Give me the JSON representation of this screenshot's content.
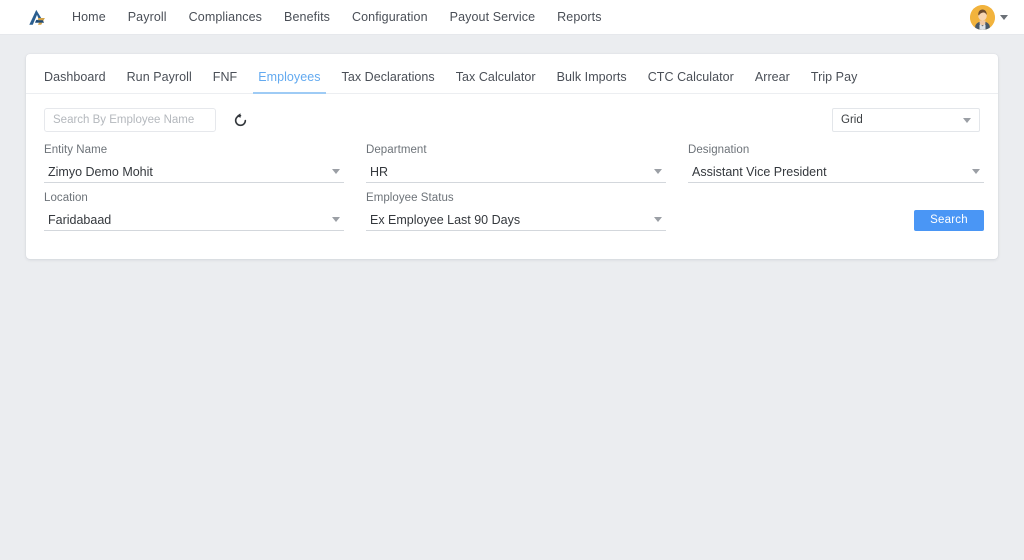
{
  "topbar": {
    "logo_icon": "arrow-a-logo-icon",
    "nav_items": [
      {
        "label": "Home"
      },
      {
        "label": "Payroll"
      },
      {
        "label": "Compliances"
      },
      {
        "label": "Benefits"
      },
      {
        "label": "Configuration"
      },
      {
        "label": "Payout Service"
      },
      {
        "label": "Reports"
      }
    ],
    "user": {
      "avatar_icon": "user-avatar",
      "caret_icon": "chevron-down-icon"
    }
  },
  "tabs": [
    {
      "label": "Dashboard",
      "active": false
    },
    {
      "label": "Run Payroll",
      "active": false
    },
    {
      "label": "FNF",
      "active": false
    },
    {
      "label": "Employees",
      "active": true
    },
    {
      "label": "Tax Declarations",
      "active": false
    },
    {
      "label": "Tax Calculator",
      "active": false
    },
    {
      "label": "Bulk Imports",
      "active": false
    },
    {
      "label": "CTC Calculator",
      "active": false
    },
    {
      "label": "Arrear",
      "active": false
    },
    {
      "label": "Trip Pay",
      "active": false
    }
  ],
  "toolbar": {
    "search": {
      "placeholder": "Search By Employee Name",
      "value": ""
    },
    "reset_icon": "refresh-reset-icon",
    "view_select": {
      "value": "Grid",
      "caret_icon": "chevron-down-icon"
    }
  },
  "filters": {
    "entity_name": {
      "label": "Entity Name",
      "value": "Zimyo Demo Mohit"
    },
    "department": {
      "label": "Department",
      "value": "HR"
    },
    "designation": {
      "label": "Designation",
      "value": "Assistant Vice President"
    },
    "location": {
      "label": "Location",
      "value": "Faridabaad"
    },
    "employee_status": {
      "label": "Employee Status",
      "value": "Ex Employee Last 90 Days"
    }
  },
  "actions": {
    "search_label": "Search"
  },
  "colors": {
    "accent_blue": "#4a96f5",
    "active_tab": "#63aaf0",
    "page_background": "#ebedf0",
    "avatar_background": "#f2b33d"
  }
}
